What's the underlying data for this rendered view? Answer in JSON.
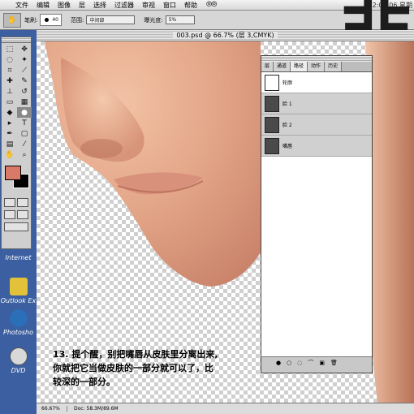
{
  "menubar": {
    "items": [
      "文件",
      "编辑",
      "图像",
      "层",
      "选择",
      "过滤器",
      "审视",
      "窗口",
      "帮助"
    ],
    "clock": "22:02:06 星期"
  },
  "options": {
    "brush_label": "笔刷:",
    "brush_size": "40",
    "range_label": "范围:",
    "range_value": "中间部",
    "exposure_label": "曝光度:",
    "exposure_value": "5%"
  },
  "document": {
    "title": "003.psd @ 66.7% (层 3,CMYK)",
    "zoom": "66.67%",
    "doc_size": "Doc: 58.3M/89.6M"
  },
  "panel": {
    "tabs": [
      "层",
      "通道",
      "路径",
      "动作",
      "历史"
    ],
    "active_tab": "路径",
    "paths": [
      "轮廓",
      "脸 1",
      "脸 2",
      "嘴唇"
    ]
  },
  "desktop": {
    "items": [
      "Internet",
      "Outlook Ex",
      "Photosho",
      "DVD"
    ]
  },
  "caption": {
    "line1": "13. 提个醒，别把嘴唇从皮肤里分离出来,",
    "line2": "你就把它当做皮肤的一部分就可以了，比",
    "line3": "较深的一部分。"
  },
  "watermark": "非",
  "colors": {
    "skin": "#e0a182",
    "foreground": "#d97a68",
    "background": "#000000"
  }
}
